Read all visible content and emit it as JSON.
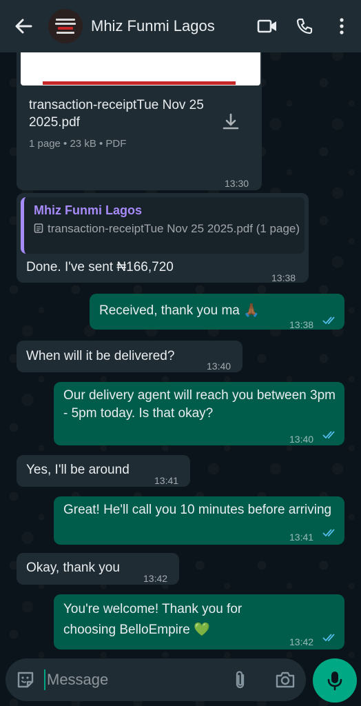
{
  "header": {
    "contact_name": "Mhiz Funmi Lagos",
    "avatar_lines": [
      "Nothing stoping you if",
      "Where are you making the",
      "BELLO EMPIRE"
    ]
  },
  "messages": [
    {
      "type": "document",
      "direction": "incoming",
      "file_name": "transaction-receiptTue Nov 25 2025.pdf",
      "meta": "1 page • 23 kB • PDF",
      "time": "13:30"
    },
    {
      "type": "reply",
      "direction": "incoming",
      "quote_author": "Mhiz Funmi Lagos",
      "quote_text": "transaction-receiptTue Nov 25 2025.pdf (1 page)",
      "text": "Done. I've sent ₦166,720",
      "time": "13:38"
    },
    {
      "direction": "outgoing",
      "text": "Received, thank you ma 🙏🏾",
      "time": "13:38",
      "read": true
    },
    {
      "direction": "incoming",
      "text": "When will it be delivered?",
      "time": "13:40"
    },
    {
      "direction": "outgoing",
      "text": "Our delivery agent will reach you between 3pm - 5pm today. Is that okay?",
      "time": "13:40",
      "read": true
    },
    {
      "direction": "incoming",
      "text": "Yes, I'll be around",
      "time": "13:41"
    },
    {
      "direction": "outgoing",
      "text": "Great! He'll call you 10 minutes before arriving",
      "time": "13:41",
      "read": true
    },
    {
      "direction": "incoming",
      "text": "Okay, thank you",
      "time": "13:42"
    },
    {
      "direction": "outgoing",
      "text": "You're welcome! Thank you for choosing BelloEmpire 💚",
      "time": "13:42",
      "read": true
    }
  ],
  "composer": {
    "placeholder": "Message"
  },
  "colors": {
    "incoming_bubble": "#1f2c34",
    "outgoing_bubble": "#005c4b",
    "accent": "#00a884",
    "read_ticks": "#53bdeb",
    "quote_author": "#a78bfa"
  }
}
